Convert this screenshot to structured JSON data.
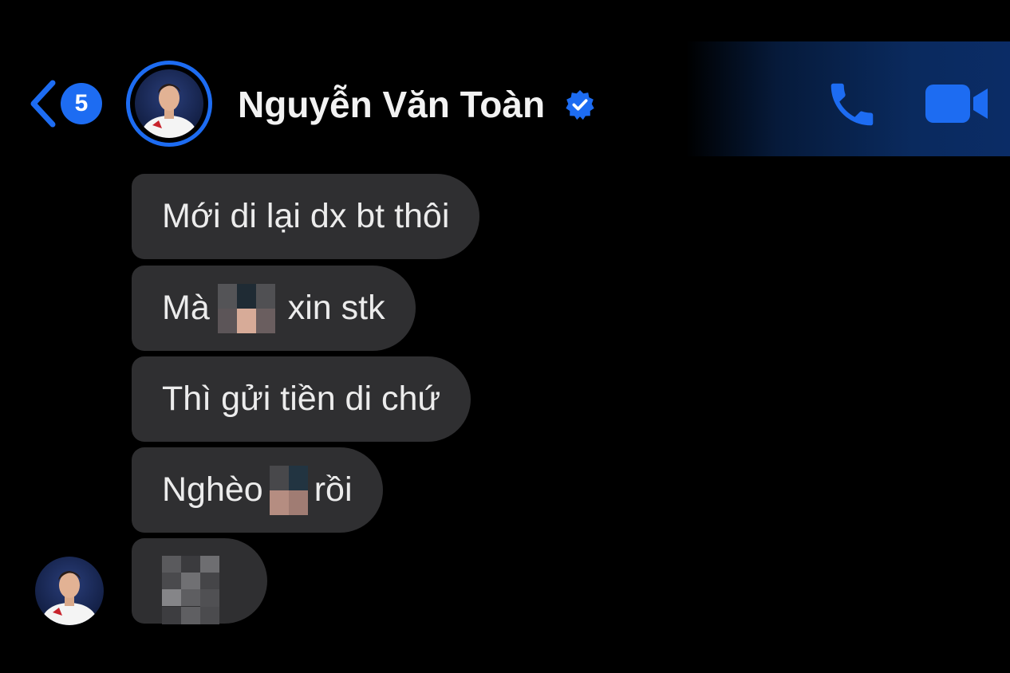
{
  "header": {
    "back_badge": "5",
    "contact_name": "Nguyễn Văn Toàn",
    "accent_color": "#1d6cf2",
    "icons": [
      "chevron-left-icon",
      "verified-badge-icon",
      "phone-icon",
      "video-camera-icon"
    ]
  },
  "messages": [
    {
      "text": "Mới di lại dx bt thôi"
    },
    {
      "text_before": "Mà",
      "text_after": "xin stk",
      "censored": true
    },
    {
      "text": "Thì gửi tiền di chứ"
    },
    {
      "text_before": "Nghèo",
      "text_after": "rồi",
      "censored": true
    },
    {
      "censored_only": true
    }
  ],
  "colors": {
    "bubble": "#2f2f31",
    "background": "#000000"
  }
}
